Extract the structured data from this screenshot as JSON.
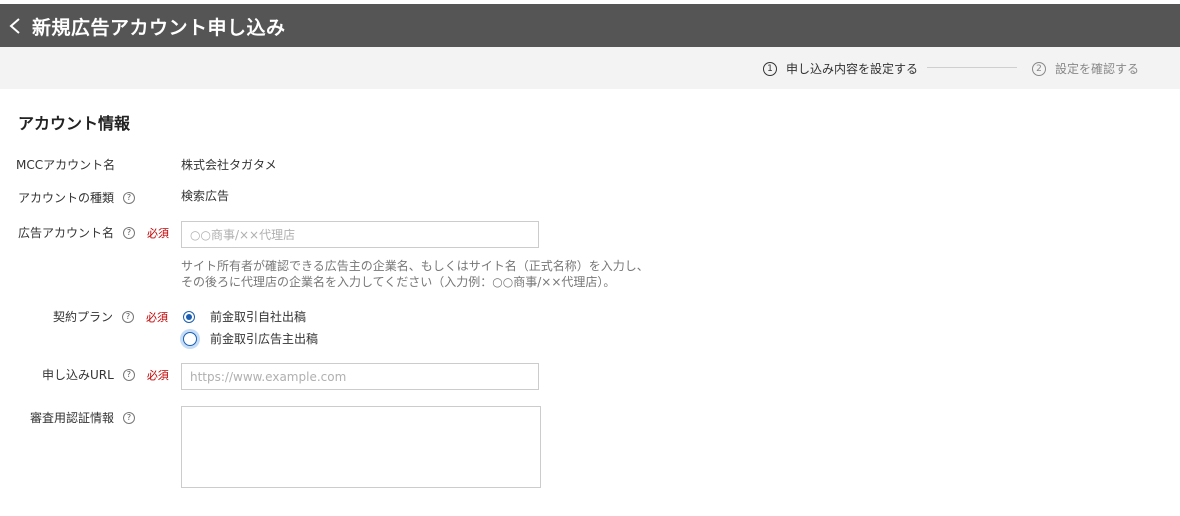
{
  "header": {
    "title": "新規広告アカウント申し込み"
  },
  "steps": [
    {
      "number": "1",
      "label": "申し込み内容を設定する"
    },
    {
      "number": "2",
      "label": "設定を確認する"
    }
  ],
  "section": {
    "title": "アカウント情報"
  },
  "fields": {
    "mcc": {
      "label": "MCCアカウント名",
      "value": "株式会社タガタメ"
    },
    "account_type": {
      "label": "アカウントの種類",
      "value": "検索広告",
      "help": "?"
    },
    "ad_account_name": {
      "label": "広告アカウント名",
      "help": "?",
      "required": "必須",
      "value": "",
      "placeholder": "○○商事/××代理店",
      "hint_line1": "サイト所有者が確認できる広告主の企業名、もしくはサイト名（正式名称）を入力し、",
      "hint_line2": "その後ろに代理店の企業名を入力してください（入力例：○○商事/××代理店）。"
    },
    "contract_plan": {
      "label": "契約プラン",
      "help": "?",
      "required": "必須",
      "options": [
        {
          "label": "前金取引自社出稿",
          "checked": true
        },
        {
          "label": "前金取引広告主出稿",
          "checked": false
        }
      ]
    },
    "apply_url": {
      "label": "申し込みURL",
      "help": "?",
      "required": "必須",
      "value": "",
      "placeholder": "https://www.example.com"
    },
    "review_auth": {
      "label": "審査用認証情報",
      "help": "?",
      "value": ""
    }
  },
  "colors": {
    "header_bg": "#555555",
    "steps_bg": "#f3f3f3",
    "required": "#c00000",
    "radio_accent": "#1a5fb4"
  }
}
